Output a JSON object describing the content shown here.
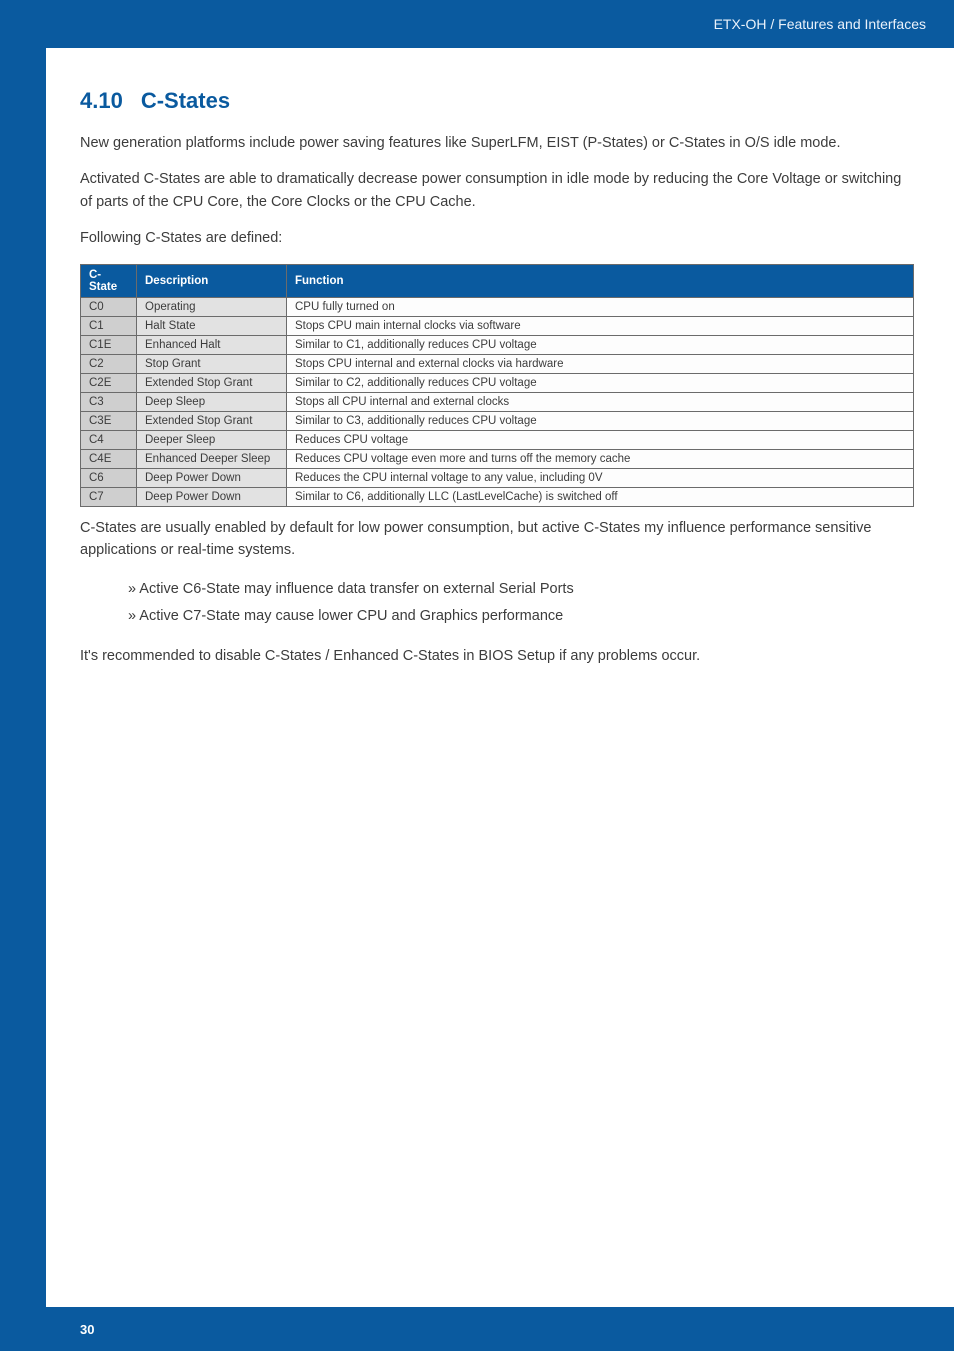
{
  "header": {
    "breadcrumb": "ETX-OH / Features and Interfaces"
  },
  "section": {
    "number": "4.10",
    "title": "C-States"
  },
  "paragraphs": {
    "p1": "New generation platforms include power saving features like SuperLFM, EIST (P-States) or C-States in O/S idle mode.",
    "p2": "Activated C-States are able to dramatically decrease power consumption in idle mode by reducing the Core Voltage or switching of parts of the CPU Core, the Core Clocks or the CPU Cache.",
    "p3": "Following C-States are defined:",
    "p4": "C-States are usually enabled by default for low power consumption, but active C-States my influence performance sensitive applications or real-time systems.",
    "b1": "Active C6-State may influence data transfer on external Serial Ports",
    "b2": "Active C7-State may cause lower CPU and Graphics performance",
    "p5": "It's recommended to disable C-States / Enhanced C-States in BIOS Setup if any problems occur."
  },
  "table": {
    "headers": {
      "c": "C-State",
      "d": "Description",
      "f": "Function"
    },
    "rows": [
      {
        "c": "C0",
        "d": "Operating",
        "f": "CPU fully turned on"
      },
      {
        "c": "C1",
        "d": "Halt State",
        "f": "Stops CPU main internal clocks via software"
      },
      {
        "c": "C1E",
        "d": "Enhanced Halt",
        "f": "Similar to C1, additionally reduces CPU voltage"
      },
      {
        "c": "C2",
        "d": "Stop Grant",
        "f": "Stops CPU internal and external clocks via hardware"
      },
      {
        "c": "C2E",
        "d": "Extended Stop Grant",
        "f": "Similar to C2, additionally reduces CPU voltage"
      },
      {
        "c": "C3",
        "d": "Deep Sleep",
        "f": "Stops all CPU internal and external clocks"
      },
      {
        "c": "C3E",
        "d": "Extended Stop Grant",
        "f": "Similar to C3, additionally reduces CPU voltage"
      },
      {
        "c": "C4",
        "d": "Deeper Sleep",
        "f": "Reduces CPU voltage"
      },
      {
        "c": "C4E",
        "d": "Enhanced Deeper Sleep",
        "f": "Reduces CPU voltage even more and turns off the memory cache"
      },
      {
        "c": "C6",
        "d": "Deep Power Down",
        "f": "Reduces the CPU internal voltage to any value, including 0V"
      },
      {
        "c": "C7",
        "d": "Deep Power Down",
        "f": "Similar to C6, additionally LLC (LastLevelCache) is switched off"
      }
    ]
  },
  "footer": {
    "page": "30"
  }
}
